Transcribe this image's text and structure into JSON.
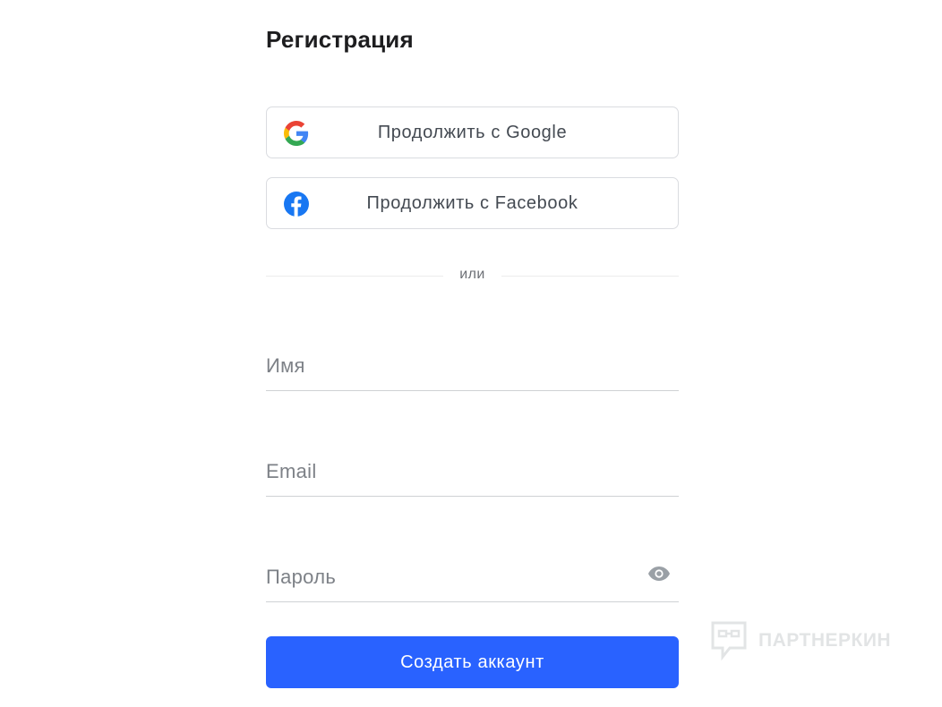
{
  "page": {
    "title": "Регистрация"
  },
  "social": {
    "google_label": "Продолжить с Google",
    "facebook_label": "Продолжить с Facebook"
  },
  "divider": {
    "text": "или"
  },
  "fields": {
    "name_placeholder": "Имя",
    "name_value": "",
    "email_placeholder": "Email",
    "email_value": "",
    "password_placeholder": "Пароль",
    "password_value": ""
  },
  "submit": {
    "label": "Создать аккаунт"
  },
  "watermark": {
    "text": "ПАРТНЕРКИН"
  },
  "colors": {
    "primary": "#2962ff",
    "facebook": "#1877f2",
    "google_blue": "#4285f4",
    "google_red": "#ea4335",
    "google_yellow": "#fbbc05",
    "google_green": "#34a853"
  },
  "icons": {
    "google": "google-logo-icon",
    "facebook": "facebook-logo-icon",
    "eye": "eye-icon",
    "watermark": "chat-bubble-icon"
  }
}
